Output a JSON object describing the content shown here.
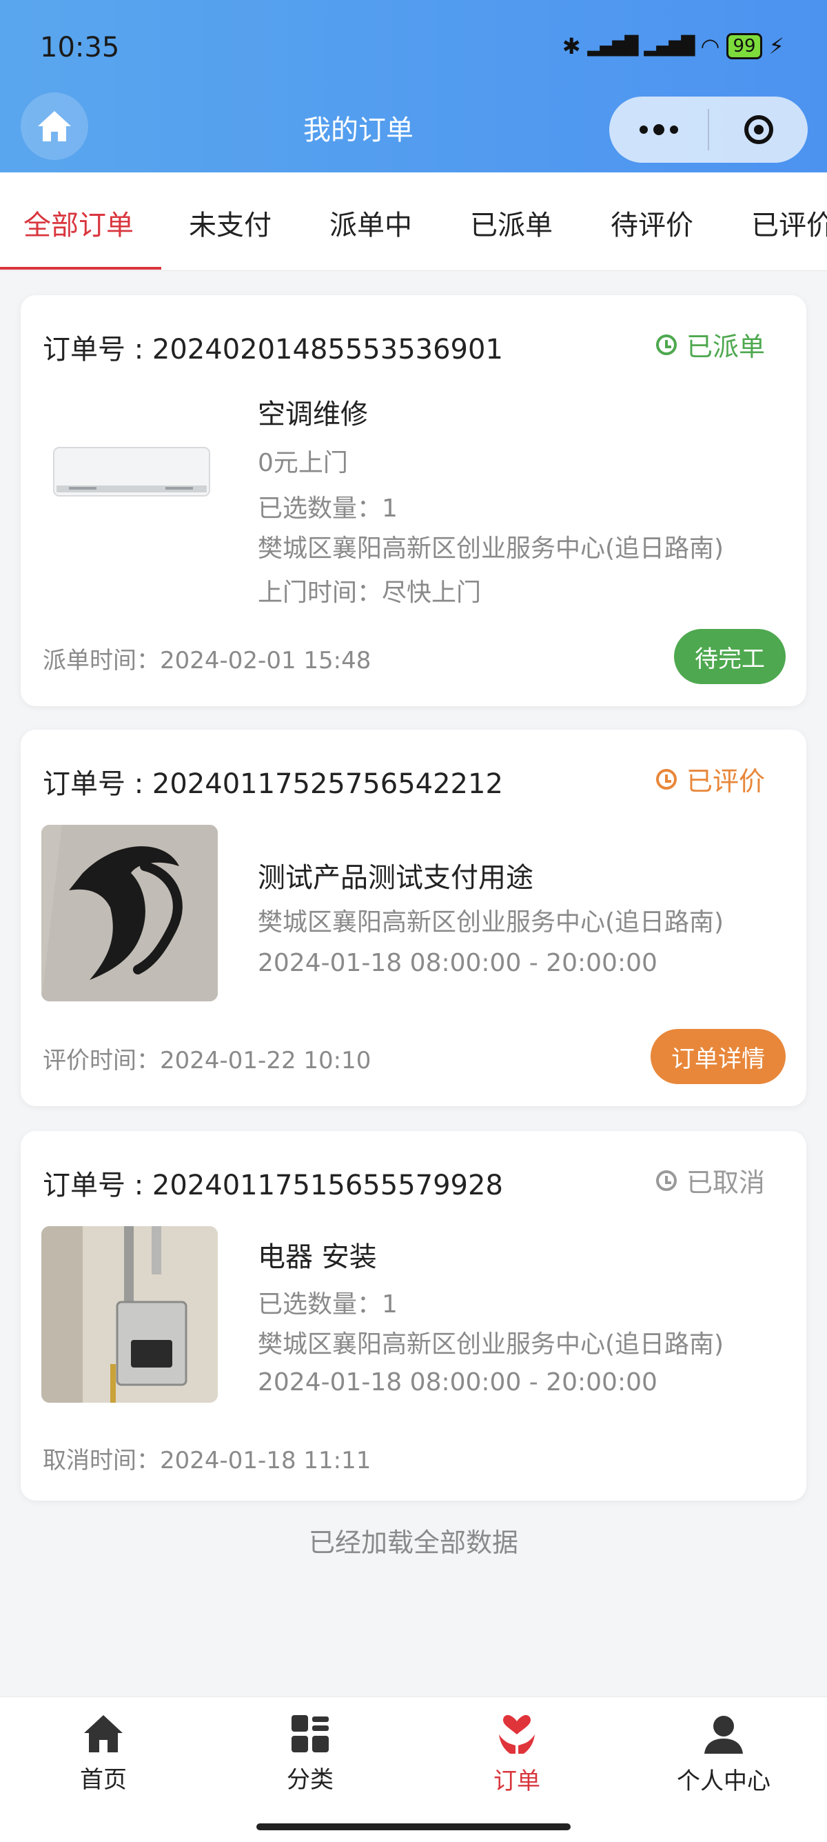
{
  "status_bar": {
    "time": "10:35",
    "battery": "99"
  },
  "nav": {
    "title": "我的订单"
  },
  "tabs": [
    "全部订单",
    "未支付",
    "派单中",
    "已派单",
    "待评价",
    "已评价"
  ],
  "orders": [
    {
      "order_no": "订单号 : 20240201485553536901",
      "status": "已派单",
      "title": "空调维修",
      "lines": [
        "0元上门",
        "已选数量：1",
        "樊城区襄阳高新区创业服务中心(追日路南)",
        "上门时间：尽快上门"
      ],
      "footer": "派单时间：2024-02-01 15:48",
      "action": "待完工",
      "status_color": "#4ea84f",
      "action_color": "#4ea84f"
    },
    {
      "order_no": "订单号 : 20240117525756542212",
      "status": "已评价",
      "title": "测试产品测试支付用途",
      "lines": [
        "樊城区襄阳高新区创业服务中心(追日路南)",
        "2024-01-18 08:00:00 - 20:00:00"
      ],
      "footer": "评价时间：2024-01-22 10:10",
      "action": "订单详情",
      "status_color": "#e8873a",
      "action_color": "#e8873a"
    },
    {
      "order_no": "订单号 : 20240117515655579928",
      "status": "已取消",
      "title": "电器 安装",
      "lines": [
        "已选数量：1",
        "樊城区襄阳高新区创业服务中心(追日路南)",
        "2024-01-18 08:00:00 - 20:00:00"
      ],
      "footer": "取消时间：2024-01-18 11:11",
      "status_color": "#999999"
    }
  ],
  "loaded_text": "已经加载全部数据",
  "bottom_nav": [
    "首页",
    "分类",
    "订单",
    "个人中心"
  ]
}
